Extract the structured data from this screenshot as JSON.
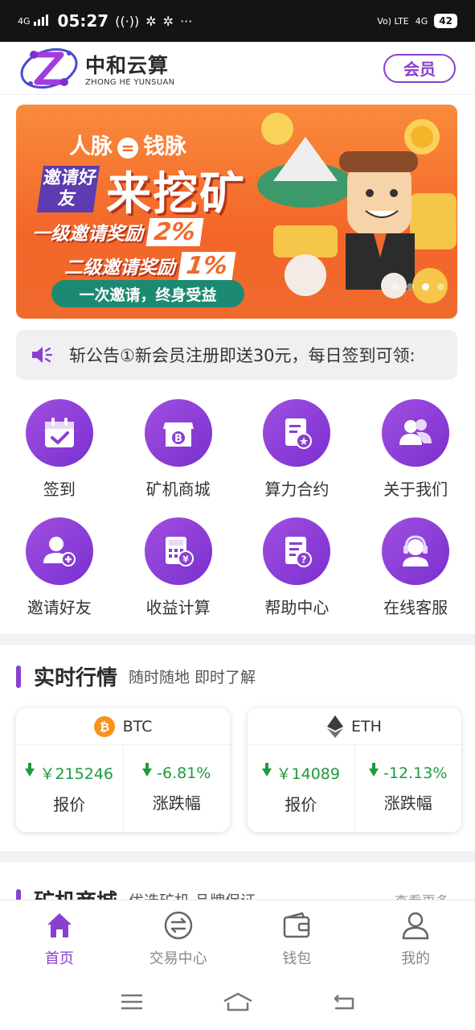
{
  "status_bar": {
    "network_left": "4G",
    "time": "05:27",
    "extra": "···",
    "volte": "Vo) LTE",
    "network_right": "4G",
    "battery": "42"
  },
  "header": {
    "logo_cn": "中和云算",
    "logo_en": "ZHONG HE YUNSUAN",
    "vip_label": "会员"
  },
  "banner": {
    "line1_left": "人脉",
    "line1_eq": "=",
    "line1_right": "钱脉",
    "invite_box": "邀请好友",
    "headline": "来挖矿",
    "level1_label": "一级邀请奖励",
    "level1_pct": "2%",
    "level2_label": "二级邀请奖励",
    "level2_pct": "1%",
    "pill": "一次邀请，终身受益",
    "active_slide_index": 2,
    "slide_count": 4
  },
  "notice": {
    "icon": "speaker-icon",
    "text": "斩公告①新会员注册即送30元，每日签到可领:"
  },
  "features": [
    {
      "name": "sign-in",
      "label": "签到",
      "icon": "calendar-check-icon"
    },
    {
      "name": "miner-shop",
      "label": "矿机商城",
      "icon": "bitcoin-shop-icon"
    },
    {
      "name": "hashrate-contract",
      "label": "算力合约",
      "icon": "contract-icon"
    },
    {
      "name": "about-us",
      "label": "关于我们",
      "icon": "people-icon"
    },
    {
      "name": "invite-friends",
      "label": "邀请好友",
      "icon": "add-user-icon"
    },
    {
      "name": "earnings-calc",
      "label": "收益计算",
      "icon": "calculator-icon"
    },
    {
      "name": "help-center",
      "label": "帮助中心",
      "icon": "help-doc-icon"
    },
    {
      "name": "online-service",
      "label": "在线客服",
      "icon": "headset-icon"
    }
  ],
  "market": {
    "title": "实时行情",
    "subtitle": "随时随地  即时了解",
    "coins": [
      {
        "symbol": "BTC",
        "price": "￥215246",
        "price_label": "报价",
        "change": "-6.81%",
        "change_label": "涨跌幅",
        "color": "#f7931a"
      },
      {
        "symbol": "ETH",
        "price": "￥14089",
        "price_label": "报价",
        "change": "-12.13%",
        "change_label": "涨跌幅",
        "color": "#3c3c3d"
      }
    ],
    "down_color": "#1f9a3c"
  },
  "miner_section": {
    "title": "矿机商城",
    "subtitle": "优选矿机  品牌保证",
    "more": "查看更多 ›"
  },
  "tabbar": [
    {
      "label": "首页",
      "icon": "home-icon",
      "active": true
    },
    {
      "label": "交易中心",
      "icon": "exchange-icon",
      "active": false
    },
    {
      "label": "钱包",
      "icon": "wallet-icon",
      "active": false
    },
    {
      "label": "我的",
      "icon": "user-icon",
      "active": false
    }
  ],
  "colors": {
    "accent": "#8a3fd1",
    "banner": "#f3662a"
  }
}
